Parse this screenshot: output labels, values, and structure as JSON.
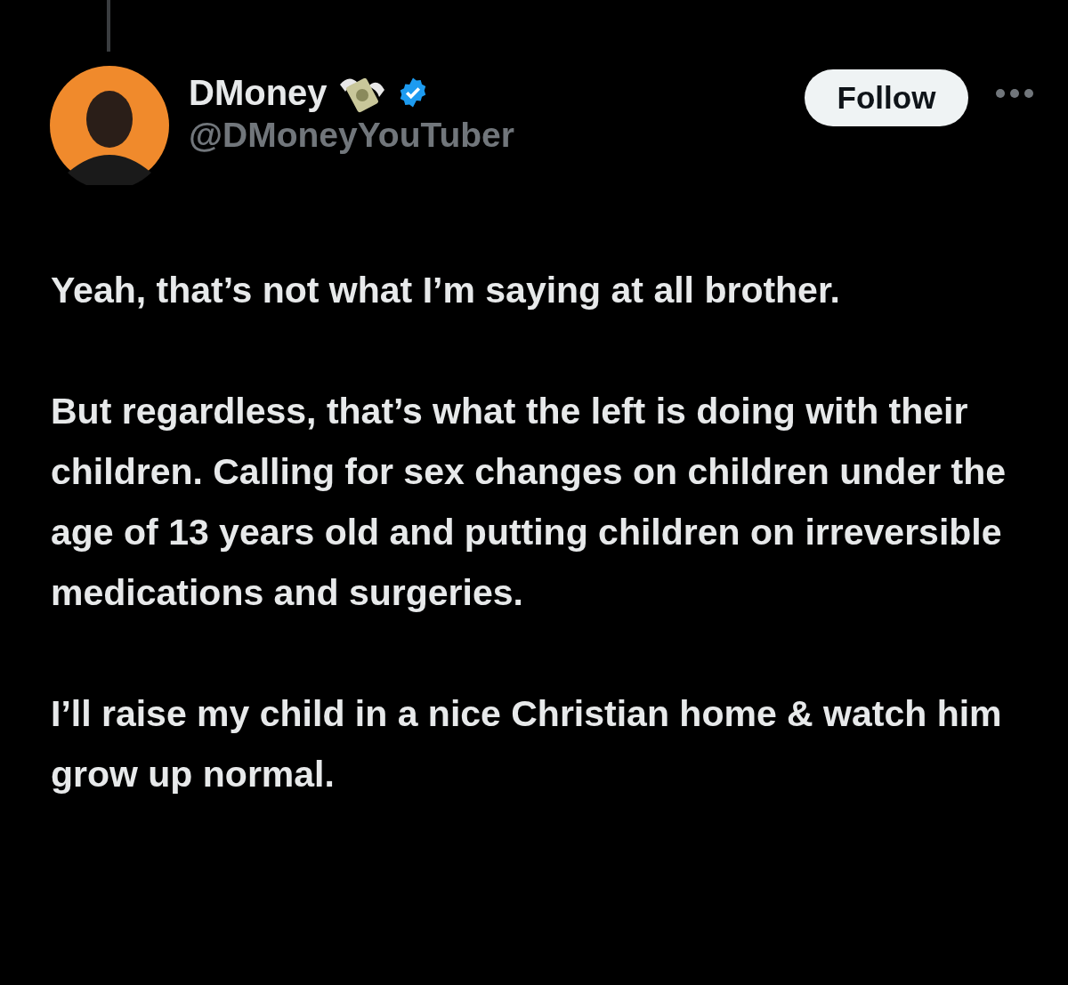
{
  "author": {
    "name": "DMoney",
    "handle": "@DMoneyYouTuber",
    "verified": true
  },
  "follow_button": {
    "label": "Follow"
  },
  "body": [
    "Yeah, that’s not what I’m saying at all brother.",
    "But regardless, that’s what the left is doing with their children. Calling for sex changes on children under the age of 13 years old and putting children on irreversible medications and surgeries.",
    "I’ll raise my child in a nice Christian home & watch him grow up normal."
  ]
}
